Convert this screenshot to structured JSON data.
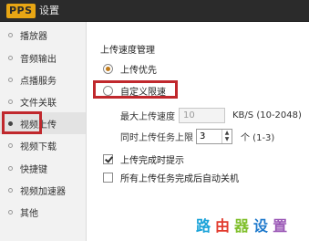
{
  "window": {
    "logo": "PPS",
    "title": "设置"
  },
  "sidebar": {
    "items": [
      {
        "label": "播放器"
      },
      {
        "label": "音频输出"
      },
      {
        "label": "点播服务"
      },
      {
        "label": "文件关联"
      },
      {
        "label": "视频上传",
        "active": true
      },
      {
        "label": "视频下载"
      },
      {
        "label": "快捷键"
      },
      {
        "label": "视频加速器"
      },
      {
        "label": "其他"
      }
    ]
  },
  "upload": {
    "section_title": "上传速度管理",
    "option_priority": "上传优先",
    "option_custom": "自定义限速",
    "selected_option": "上传优先",
    "max_speed_label": "最大上传速度",
    "max_speed_value": "10",
    "max_speed_unit": "KB/S (10-2048)",
    "tasks_label": "同时上传任务上限",
    "tasks_value": "3",
    "tasks_unit": "个 (1-3)",
    "notify_label": "上传完成时提示",
    "notify_checked": true,
    "shutdown_label": "所有上传任务完成后自动关机",
    "shutdown_checked": false
  },
  "watermark": {
    "chars": [
      "路",
      "由",
      "器",
      "设",
      "置"
    ],
    "colors": [
      "#1aa3d9",
      "#e23b2e",
      "#7fbf2a",
      "#1f7acc",
      "#9b59b6"
    ]
  }
}
